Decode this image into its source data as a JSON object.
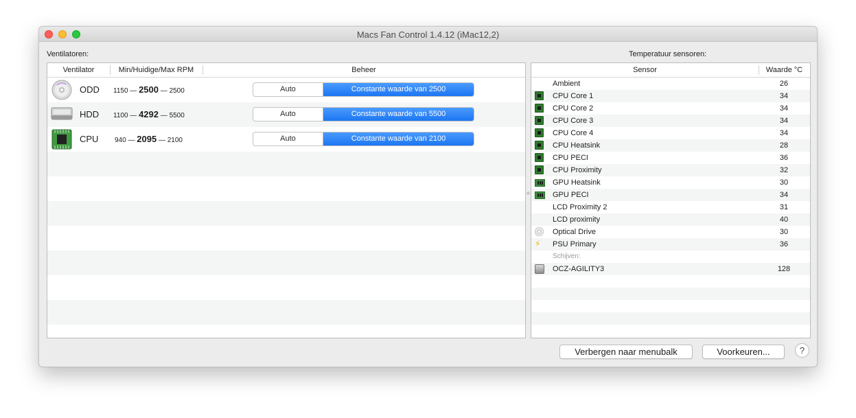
{
  "window": {
    "title": "Macs Fan Control 1.4.12 (iMac12,2)"
  },
  "fans_section": {
    "label": "Ventilatoren:",
    "headers": {
      "fan": "Ventilator",
      "rpm": "Min/Huidige/Max RPM",
      "control": "Beheer"
    },
    "rows": [
      {
        "name": "ODD",
        "icon": "optical-disc-icon",
        "min": "1150",
        "current": "2500",
        "max": "2500",
        "auto_label": "Auto",
        "constant_label": "Constante waarde van 2500"
      },
      {
        "name": "HDD",
        "icon": "hard-drive-icon",
        "min": "1100",
        "current": "4292",
        "max": "5500",
        "auto_label": "Auto",
        "constant_label": "Constante waarde van 5500"
      },
      {
        "name": "CPU",
        "icon": "cpu-chip-icon",
        "min": "940",
        "current": "2095",
        "max": "2100",
        "auto_label": "Auto",
        "constant_label": "Constante waarde van 2100"
      }
    ],
    "rpm_separator": "—"
  },
  "sensors_section": {
    "label": "Temperatuur sensoren:",
    "headers": {
      "sensor": "Sensor",
      "value": "Waarde °C"
    },
    "rows": [
      {
        "name": "Ambient",
        "value": "26",
        "icon": ""
      },
      {
        "name": "CPU Core 1",
        "value": "34",
        "icon": "cpu-chip-icon"
      },
      {
        "name": "CPU Core 2",
        "value": "34",
        "icon": "cpu-chip-icon"
      },
      {
        "name": "CPU Core 3",
        "value": "34",
        "icon": "cpu-chip-icon"
      },
      {
        "name": "CPU Core 4",
        "value": "34",
        "icon": "cpu-chip-icon"
      },
      {
        "name": "CPU Heatsink",
        "value": "28",
        "icon": "cpu-chip-icon"
      },
      {
        "name": "CPU PECI",
        "value": "36",
        "icon": "cpu-chip-icon"
      },
      {
        "name": "CPU Proximity",
        "value": "32",
        "icon": "cpu-chip-icon"
      },
      {
        "name": "GPU Heatsink",
        "value": "30",
        "icon": "gpu-card-icon"
      },
      {
        "name": "GPU PECI",
        "value": "34",
        "icon": "gpu-card-icon"
      },
      {
        "name": "LCD Proximity 2",
        "value": "31",
        "icon": ""
      },
      {
        "name": "LCD proximity",
        "value": "40",
        "icon": ""
      },
      {
        "name": "Optical Drive",
        "value": "30",
        "icon": "optical-disc-icon"
      },
      {
        "name": "PSU Primary",
        "value": "36",
        "icon": "lightning-bolt-icon"
      }
    ],
    "group_label": "Schijven:",
    "disk_rows": [
      {
        "name": "OCZ-AGILITY3",
        "value": "128",
        "icon": "hard-drive-icon"
      }
    ]
  },
  "buttons": {
    "hide_to_menubar": "Verbergen naar menubalk",
    "preferences": "Voorkeuren...",
    "help": "?"
  },
  "colors": {
    "accent": "#1d76f2",
    "stripe": "#f4f5f5",
    "window_bg": "#ececec"
  }
}
